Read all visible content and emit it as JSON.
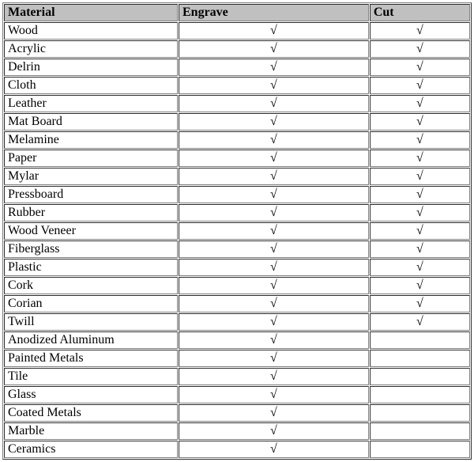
{
  "columns": {
    "material": "Material",
    "engrave": "Engrave",
    "cut": "Cut"
  },
  "checkmark": "√",
  "rows": [
    {
      "material": "Wood",
      "engrave": true,
      "cut": true
    },
    {
      "material": "Acrylic",
      "engrave": true,
      "cut": true
    },
    {
      "material": "Delrin",
      "engrave": true,
      "cut": true
    },
    {
      "material": "Cloth",
      "engrave": true,
      "cut": true
    },
    {
      "material": "Leather",
      "engrave": true,
      "cut": true
    },
    {
      "material": "Mat Board",
      "engrave": true,
      "cut": true
    },
    {
      "material": "Melamine",
      "engrave": true,
      "cut": true
    },
    {
      "material": "Paper",
      "engrave": true,
      "cut": true
    },
    {
      "material": "Mylar",
      "engrave": true,
      "cut": true
    },
    {
      "material": "Pressboard",
      "engrave": true,
      "cut": true
    },
    {
      "material": "Rubber",
      "engrave": true,
      "cut": true
    },
    {
      "material": "Wood Veneer",
      "engrave": true,
      "cut": true
    },
    {
      "material": "Fiberglass",
      "engrave": true,
      "cut": true
    },
    {
      "material": "Plastic",
      "engrave": true,
      "cut": true
    },
    {
      "material": "Cork",
      "engrave": true,
      "cut": true
    },
    {
      "material": "Corian",
      "engrave": true,
      "cut": true
    },
    {
      "material": "Twill",
      "engrave": true,
      "cut": true
    },
    {
      "material": "Anodized Aluminum",
      "engrave": true,
      "cut": false
    },
    {
      "material": "Painted Metals",
      "engrave": true,
      "cut": false
    },
    {
      "material": "Tile",
      "engrave": true,
      "cut": false
    },
    {
      "material": "Glass",
      "engrave": true,
      "cut": false
    },
    {
      "material": "Coated Metals",
      "engrave": true,
      "cut": false
    },
    {
      "material": "Marble",
      "engrave": true,
      "cut": false
    },
    {
      "material": "Ceramics",
      "engrave": true,
      "cut": false
    }
  ]
}
